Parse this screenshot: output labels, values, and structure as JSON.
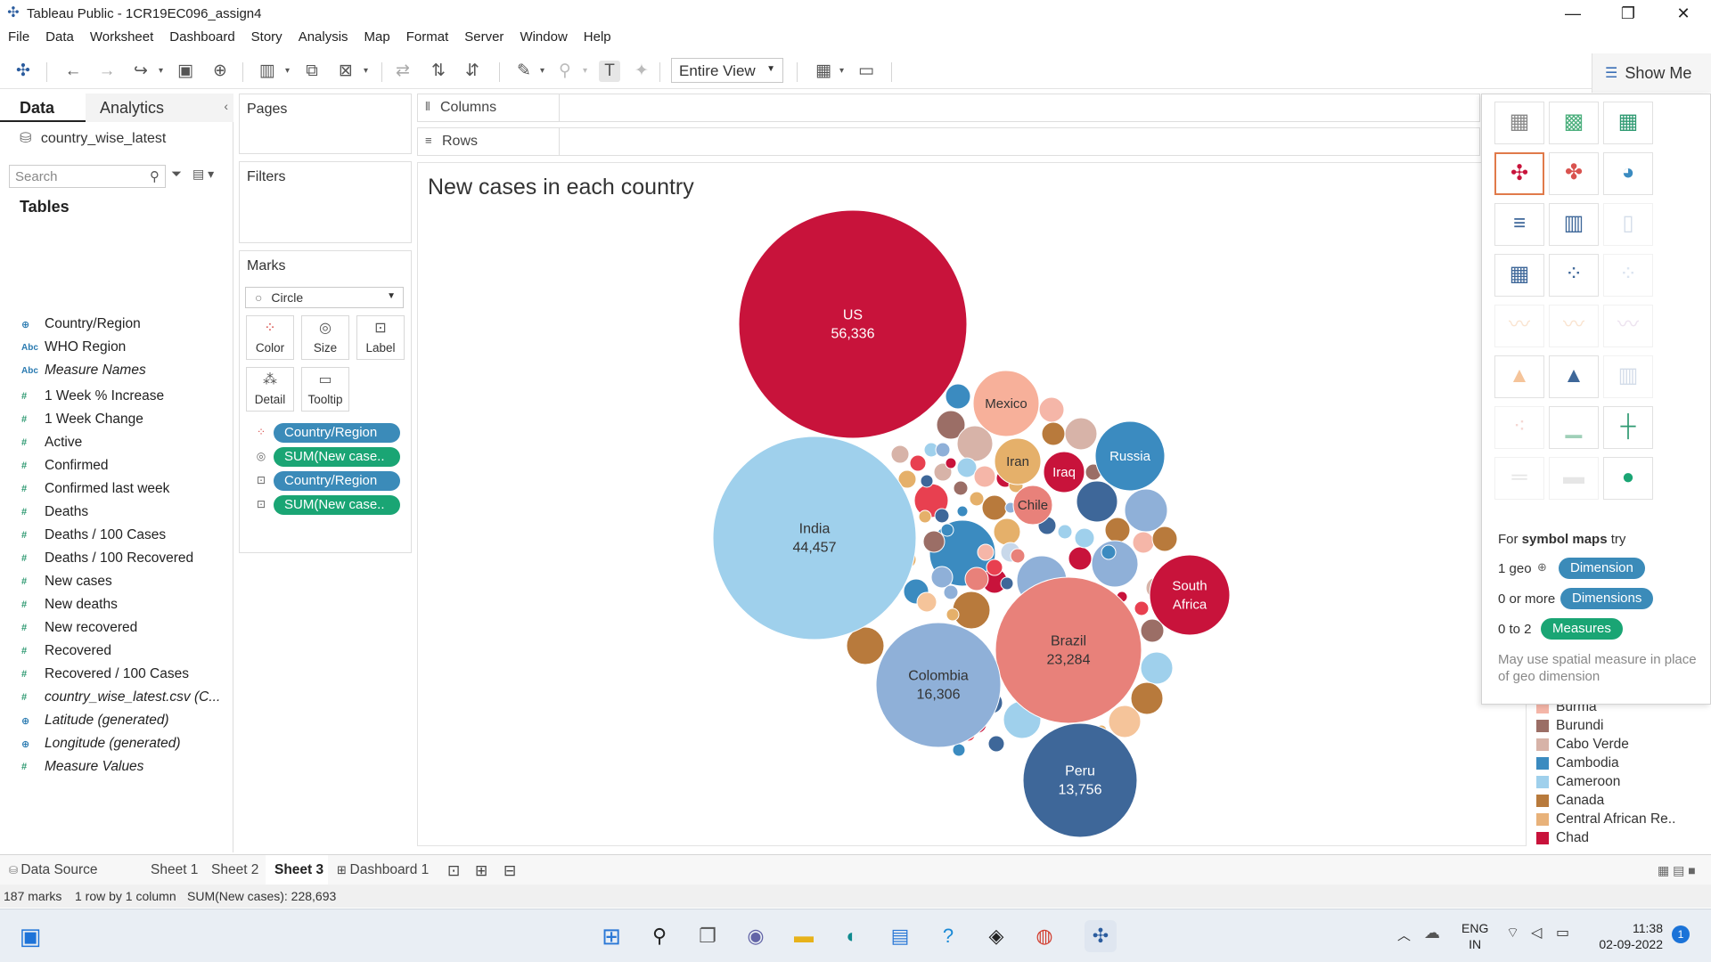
{
  "window": {
    "title": "Tableau Public - 1CR19EC096_assign4"
  },
  "menu": [
    "File",
    "Data",
    "Worksheet",
    "Dashboard",
    "Story",
    "Analysis",
    "Map",
    "Format",
    "Server",
    "Window",
    "Help"
  ],
  "toolbar": {
    "view_mode": "Entire View",
    "show_me": "Show Me"
  },
  "data_pane": {
    "tabs": [
      "Data",
      "Analytics"
    ],
    "data_source": "country_wise_latest",
    "search_placeholder": "Search",
    "tables_title": "Tables",
    "fields": [
      {
        "type": "geo",
        "name": "Country/Region",
        "italic": false
      },
      {
        "type": "abc",
        "name": "WHO Region",
        "italic": false
      },
      {
        "type": "abc",
        "name": "Measure Names",
        "italic": true
      },
      {
        "type": "num",
        "name": "1 Week % Increase",
        "italic": false
      },
      {
        "type": "num",
        "name": "1 Week Change",
        "italic": false
      },
      {
        "type": "num",
        "name": "Active",
        "italic": false
      },
      {
        "type": "num",
        "name": "Confirmed",
        "italic": false
      },
      {
        "type": "num",
        "name": "Confirmed last week",
        "italic": false
      },
      {
        "type": "num",
        "name": "Deaths",
        "italic": false
      },
      {
        "type": "num",
        "name": "Deaths / 100 Cases",
        "italic": false
      },
      {
        "type": "num",
        "name": "Deaths / 100 Recovered",
        "italic": false
      },
      {
        "type": "num",
        "name": "New cases",
        "italic": false
      },
      {
        "type": "num",
        "name": "New deaths",
        "italic": false
      },
      {
        "type": "num",
        "name": "New recovered",
        "italic": false
      },
      {
        "type": "num",
        "name": "Recovered",
        "italic": false
      },
      {
        "type": "num",
        "name": "Recovered / 100 Cases",
        "italic": false
      },
      {
        "type": "num",
        "name": "country_wise_latest.csv (C...",
        "italic": true
      },
      {
        "type": "geo",
        "name": "Latitude (generated)",
        "italic": true
      },
      {
        "type": "geo",
        "name": "Longitude (generated)",
        "italic": true
      },
      {
        "type": "num",
        "name": "Measure Values",
        "italic": true
      }
    ]
  },
  "shelves": {
    "pages": "Pages",
    "filters": "Filters",
    "marks": "Marks",
    "mark_type": "Circle",
    "mark_buttons": [
      "Color",
      "Size",
      "Label",
      "Detail",
      "Tooltip"
    ],
    "mark_pills": [
      {
        "label": "Country/Region",
        "kind": "dim"
      },
      {
        "label": "SUM(New case..",
        "kind": "mea"
      },
      {
        "label": "Country/Region",
        "kind": "dim"
      },
      {
        "label": "SUM(New case..",
        "kind": "mea"
      }
    ],
    "columns": "Columns",
    "rows": "Rows"
  },
  "view": {
    "title": "New cases in each country",
    "labeled_bubbles": [
      {
        "country": "US",
        "value": "56,336",
        "color": "#c8133b"
      },
      {
        "country": "India",
        "value": "44,457",
        "color": "#9fd0ec"
      },
      {
        "country": "Brazil",
        "value": "23,284",
        "color": "#e8817a"
      },
      {
        "country": "Colombia",
        "value": "16,306",
        "color": "#8fb0d8"
      },
      {
        "country": "Peru",
        "value": "13,756",
        "color": "#3e6799"
      },
      {
        "country": "South Africa",
        "value": "",
        "color": "#c8133b"
      },
      {
        "country": "Mexico",
        "value": "",
        "color": "#f7b09a"
      },
      {
        "country": "Russia",
        "value": "",
        "color": "#3b8bc0"
      },
      {
        "country": "Iran",
        "value": "",
        "color": "#e5b06a"
      },
      {
        "country": "Iraq",
        "value": "",
        "color": "#c8133b"
      },
      {
        "country": "Chile",
        "value": "",
        "color": "#e8817a"
      }
    ]
  },
  "show_me": {
    "hint_prefix": "For ",
    "hint_bold": "symbol maps",
    "hint_suffix": " try",
    "rows": [
      {
        "text": "1 geo",
        "pill": "Dimension",
        "kind": "dim"
      },
      {
        "text": "0 or more",
        "pill": "Dimensions",
        "kind": "dim"
      },
      {
        "text": "0 to 2",
        "pill": "Measures",
        "kind": "mea"
      }
    ],
    "note": "May use spatial measure in place of geo dimension"
  },
  "legend": [
    {
      "name": "Burma",
      "color": "#f5b6a8"
    },
    {
      "name": "Burundi",
      "color": "#9b6e66"
    },
    {
      "name": "Cabo Verde",
      "color": "#d7b3a8"
    },
    {
      "name": "Cambodia",
      "color": "#3b8bc0"
    },
    {
      "name": "Cameroon",
      "color": "#9fd0ec"
    },
    {
      "name": "Canada",
      "color": "#b87a3c"
    },
    {
      "name": "Central African Re..",
      "color": "#e8b27a"
    },
    {
      "name": "Chad",
      "color": "#c8133b"
    }
  ],
  "sheet_tabs": [
    "Data Source",
    "Sheet 1",
    "Sheet 2",
    "Sheet 3",
    "Dashboard 1"
  ],
  "active_sheet": "Sheet 3",
  "status": {
    "marks": "187 marks",
    "dims": "1 row by 1 column",
    "sum": "SUM(New cases): 228,693"
  },
  "taskbar": {
    "lang1": "ENG",
    "lang2": "IN",
    "time": "11:38",
    "date": "02-09-2022",
    "badge": "1"
  }
}
